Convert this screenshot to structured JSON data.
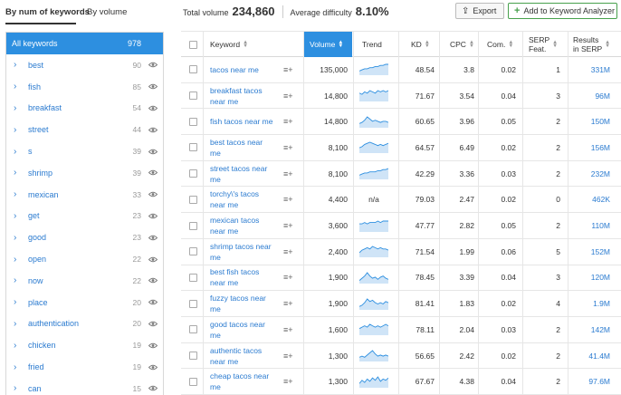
{
  "tabs": {
    "by_num": "By num of keywords",
    "by_volume": "By volume"
  },
  "totals": {
    "volume_label": "Total volume",
    "volume_value": "234,860",
    "difficulty_label": "Average difficulty",
    "difficulty_value": "8.10%"
  },
  "toolbar": {
    "export_label": "Export",
    "add_label": "Add to Keyword Analyzer"
  },
  "sidebar": {
    "all_label": "All keywords",
    "all_count": "978",
    "items": [
      {
        "label": "best",
        "count": "90"
      },
      {
        "label": "fish",
        "count": "85"
      },
      {
        "label": "breakfast",
        "count": "54"
      },
      {
        "label": "street",
        "count": "44"
      },
      {
        "label": "s",
        "count": "39"
      },
      {
        "label": "shrimp",
        "count": "39"
      },
      {
        "label": "mexican",
        "count": "33"
      },
      {
        "label": "get",
        "count": "23"
      },
      {
        "label": "good",
        "count": "23"
      },
      {
        "label": "open",
        "count": "22"
      },
      {
        "label": "now",
        "count": "22"
      },
      {
        "label": "place",
        "count": "20"
      },
      {
        "label": "authentication",
        "count": "20"
      },
      {
        "label": "chicken",
        "count": "19"
      },
      {
        "label": "fried",
        "count": "19"
      },
      {
        "label": "can",
        "count": "15"
      }
    ]
  },
  "table": {
    "headers": {
      "keyword": "Keyword",
      "volume": "Volume",
      "trend": "Trend",
      "kd": "KD",
      "cpc": "CPC",
      "com": "Com.",
      "serp1": "SERP",
      "serp2": "Feat.",
      "results1": "Results",
      "results2": "in SERP"
    },
    "rows": [
      {
        "kw1": "tacos near me",
        "kw2": "",
        "volume": "135,000",
        "trend": [
          3,
          4,
          5,
          5,
          6,
          6,
          7,
          7,
          8,
          8,
          9,
          9
        ],
        "kd": "48.54",
        "cpc": "3.8",
        "com": "0.02",
        "serp": "1",
        "results": "331M"
      },
      {
        "kw1": "breakfast tacos",
        "kw2": "near me",
        "volume": "14,800",
        "trend": [
          6,
          5,
          7,
          6,
          8,
          7,
          6,
          8,
          7,
          8,
          7,
          8
        ],
        "kd": "71.67",
        "cpc": "3.54",
        "com": "0.04",
        "serp": "3",
        "results": "96M"
      },
      {
        "kw1": "fish tacos near me",
        "kw2": "",
        "volume": "14,800",
        "trend": [
          3,
          4,
          6,
          9,
          7,
          5,
          6,
          5,
          4,
          5,
          5,
          4
        ],
        "kd": "60.65",
        "cpc": "3.96",
        "com": "0.05",
        "serp": "2",
        "results": "150M"
      },
      {
        "kw1": "best tacos near",
        "kw2": "me",
        "volume": "8,100",
        "trend": [
          4,
          5,
          7,
          8,
          9,
          8,
          7,
          6,
          7,
          6,
          7,
          8
        ],
        "kd": "64.57",
        "cpc": "6.49",
        "com": "0.02",
        "serp": "2",
        "results": "156M"
      },
      {
        "kw1": "street tacos near",
        "kw2": "me",
        "volume": "8,100",
        "trend": [
          3,
          4,
          5,
          5,
          6,
          6,
          6,
          7,
          7,
          8,
          8,
          9
        ],
        "kd": "42.29",
        "cpc": "3.36",
        "com": "0.03",
        "serp": "2",
        "results": "232M"
      },
      {
        "kw1": "torchy\\'s tacos",
        "kw2": "near me",
        "volume": "4,400",
        "trend_text": "n/a",
        "kd": "79.03",
        "cpc": "2.47",
        "com": "0.02",
        "serp": "0",
        "results": "462K"
      },
      {
        "kw1": "mexican tacos",
        "kw2": "near me",
        "volume": "3,600",
        "trend": [
          5,
          5,
          6,
          5,
          6,
          6,
          6,
          7,
          6,
          7,
          7,
          7
        ],
        "kd": "47.77",
        "cpc": "2.82",
        "com": "0.05",
        "serp": "2",
        "results": "110M"
      },
      {
        "kw1": "shrimp tacos near",
        "kw2": "me",
        "volume": "2,400",
        "trend": [
          3,
          5,
          6,
          7,
          6,
          8,
          7,
          6,
          7,
          6,
          6,
          5
        ],
        "kd": "71.54",
        "cpc": "1.99",
        "com": "0.06",
        "serp": "5",
        "results": "152M"
      },
      {
        "kw1": "best fish tacos",
        "kw2": "near me",
        "volume": "1,900",
        "trend": [
          2,
          4,
          6,
          9,
          6,
          4,
          5,
          3,
          5,
          6,
          4,
          3
        ],
        "kd": "78.45",
        "cpc": "3.39",
        "com": "0.04",
        "serp": "3",
        "results": "120M"
      },
      {
        "kw1": "fuzzy tacos near",
        "kw2": "me",
        "volume": "1,900",
        "trend": [
          2,
          3,
          5,
          8,
          6,
          7,
          5,
          4,
          5,
          4,
          6,
          5
        ],
        "kd": "81.41",
        "cpc": "1.83",
        "com": "0.02",
        "serp": "4",
        "results": "1.9M"
      },
      {
        "kw1": "good tacos near",
        "kw2": "me",
        "volume": "1,600",
        "trend": [
          4,
          5,
          6,
          5,
          7,
          6,
          5,
          6,
          5,
          6,
          7,
          6
        ],
        "kd": "78.11",
        "cpc": "2.04",
        "com": "0.03",
        "serp": "2",
        "results": "142M"
      },
      {
        "kw1": "authentic tacos",
        "kw2": "near me",
        "volume": "1,300",
        "trend": [
          3,
          4,
          3,
          5,
          7,
          9,
          6,
          4,
          5,
          4,
          5,
          4
        ],
        "kd": "56.65",
        "cpc": "2.42",
        "com": "0.02",
        "serp": "2",
        "results": "41.4M"
      },
      {
        "kw1": "cheap tacos near",
        "kw2": "me",
        "volume": "1,300",
        "trend": [
          3,
          6,
          4,
          7,
          5,
          8,
          6,
          9,
          5,
          7,
          6,
          8
        ],
        "kd": "67.67",
        "cpc": "4.38",
        "com": "0.04",
        "serp": "2",
        "results": "97.6M"
      }
    ]
  },
  "colors": {
    "accent": "#2d8fe0",
    "link": "#2b7bd0",
    "green": "#48a14d",
    "sparkline": "#2d8fe0",
    "sparkfill": "#cfe4f7"
  }
}
